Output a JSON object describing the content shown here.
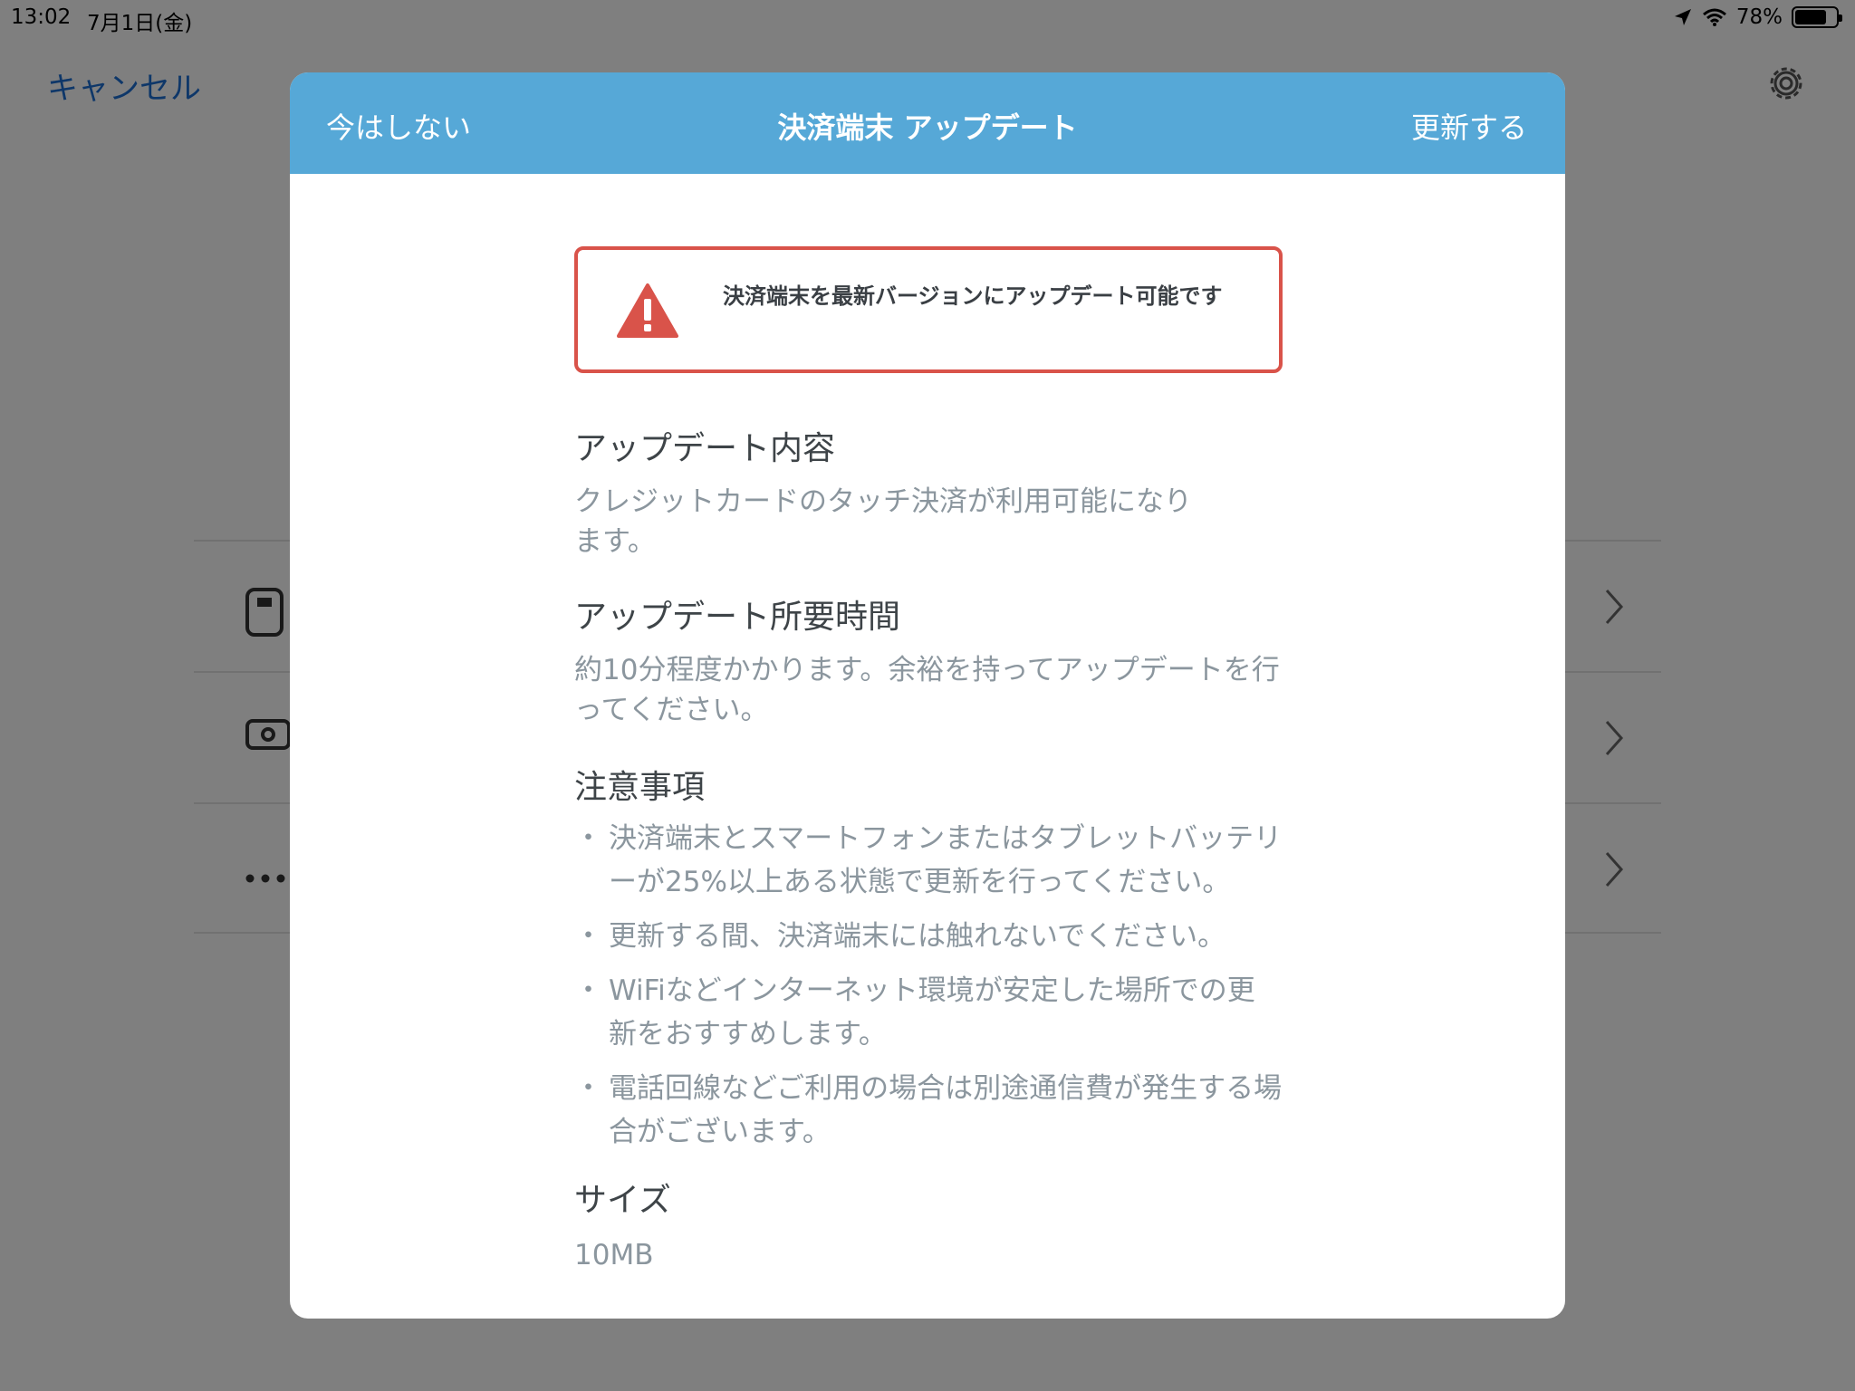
{
  "status_bar": {
    "time": "13:02",
    "date": "7月1日(金)",
    "battery": "78%",
    "battery_level": 0.78
  },
  "background": {
    "cancel_label": "キャンセル",
    "rows": [
      {
        "icon": "card-reader-icon"
      },
      {
        "icon": "cash-icon"
      },
      {
        "icon": "more-icon"
      }
    ]
  },
  "modal": {
    "header": {
      "left_label": "今はしない",
      "title": "決済端末 アップデート",
      "right_label": "更新する"
    },
    "alert": {
      "text": "決済端末を最新バージョンにアップデート可能です",
      "color": "#d9534a"
    },
    "update_content": {
      "title": "アップデート内容",
      "body": "クレジットカードのタッチ決済が利用可能になります。"
    },
    "duration": {
      "title": "アップデート所要時間",
      "body": "約10分程度かかります。余裕を持ってアップデートを行ってください。"
    },
    "notes": {
      "title": "注意事項",
      "items": [
        "決済端末とスマートフォンまたはタブレットバッテリーが25%以上ある状態で更新を行ってください。",
        "更新する間、決済端末には触れないでください。",
        "WiFiなどインターネット環境が安定した場所での更新をおすすめします。",
        "電話回線などご利用の場合は別途通信費が発生する場合がございます。"
      ]
    },
    "size": {
      "title": "サイズ",
      "value": "10MB"
    }
  },
  "colors": {
    "header": "#56a8d7",
    "link": "#1d6fd3"
  }
}
